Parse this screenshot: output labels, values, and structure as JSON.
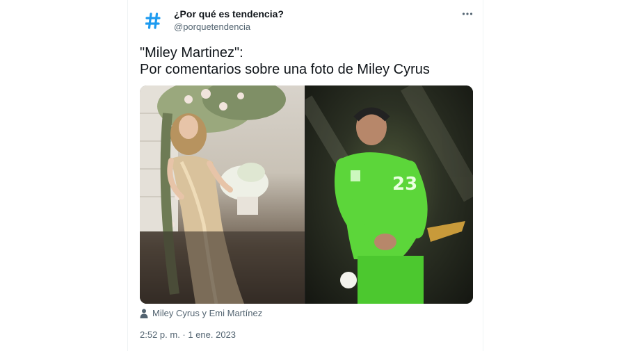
{
  "author": {
    "display_name": "¿Por qué es tendencia?",
    "handle": "@porquetendencia",
    "avatar_icon": "hashtag-icon",
    "avatar_color": "#1d9bf0"
  },
  "menu": {
    "more_icon": "more-options-icon"
  },
  "tweet": {
    "text_line_1": "\"Miley Martinez\":",
    "text_line_2": "Por comentarios sobre una foto de Miley Cyrus"
  },
  "media": {
    "photos": [
      {
        "name": "miley-photo",
        "description_icon": "photo"
      },
      {
        "name": "emi-photo",
        "description_icon": "photo"
      }
    ],
    "tags_icon": "person-icon",
    "tags_text": "Miley Cyrus y Emi Martínez"
  },
  "meta": {
    "timestamp": "2:52 p. m. · 1 ene. 2023"
  },
  "colors": {
    "secondary_text": "#536471",
    "primary_text": "#0f1419",
    "jersey_green": "#5cd63a"
  }
}
